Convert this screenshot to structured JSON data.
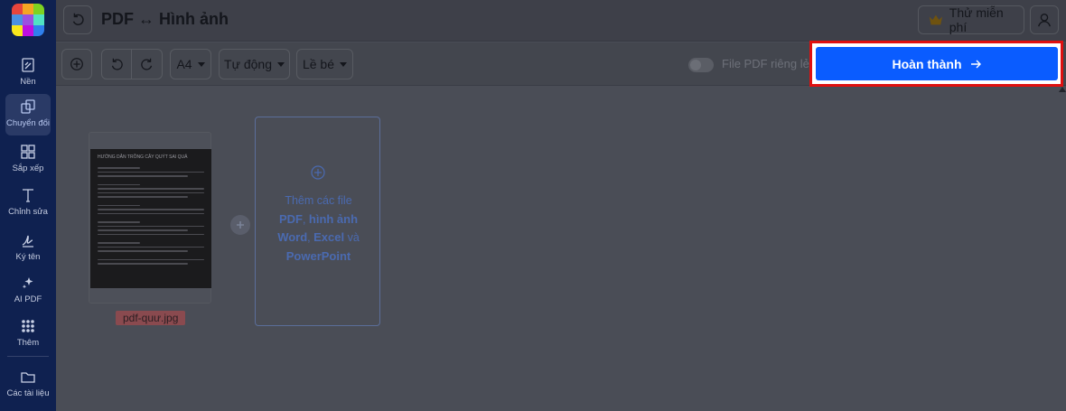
{
  "sidebar": {
    "logo_colors": [
      "#e8453c",
      "#f5a623",
      "#7ed321",
      "#4a90e2",
      "#9b51e0",
      "#50e3c2",
      "#f8e71c",
      "#bd10e0",
      "#2f80ed"
    ],
    "items": [
      {
        "label": "Nền",
        "icon": "background-icon"
      },
      {
        "label": "Chuyển đổi",
        "icon": "convert-icon"
      },
      {
        "label": "Sắp xếp",
        "icon": "grid-arrange-icon"
      },
      {
        "label": "Chỉnh sửa",
        "icon": "text-edit-icon"
      },
      {
        "label": "Ký tên",
        "icon": "signature-icon"
      },
      {
        "label": "AI PDF",
        "icon": "sparkle-icon"
      },
      {
        "label": "Thêm",
        "icon": "more-grid-icon"
      },
      {
        "label": "Các tài liệu",
        "icon": "folder-icon"
      }
    ]
  },
  "header": {
    "title": "PDF ↔ Hình ảnh",
    "trial_label": "Thử miễn phí"
  },
  "toolbar": {
    "page_size": "A4",
    "orientation": "Tự động",
    "margin": "Lề bé",
    "toggle_label": "File PDF riêng lẻ",
    "toggle_on": false,
    "done_label": "Hoàn thành"
  },
  "canvas": {
    "file": {
      "name": "pdf-quư.jpg",
      "thumb_title": "HƯỚNG DẪN TRỒNG CÂY QUÝT SAI QUẢ"
    },
    "add_card": {
      "prefix": "Thêm các file",
      "items": [
        "PDF",
        "hình ảnh",
        "Word",
        "Excel"
      ],
      "connector": "và",
      "last": "PowerPoint"
    }
  },
  "colors": {
    "sidebar_bg": "#0f2150",
    "primary": "#0a5cff",
    "highlight": "#e01010"
  }
}
